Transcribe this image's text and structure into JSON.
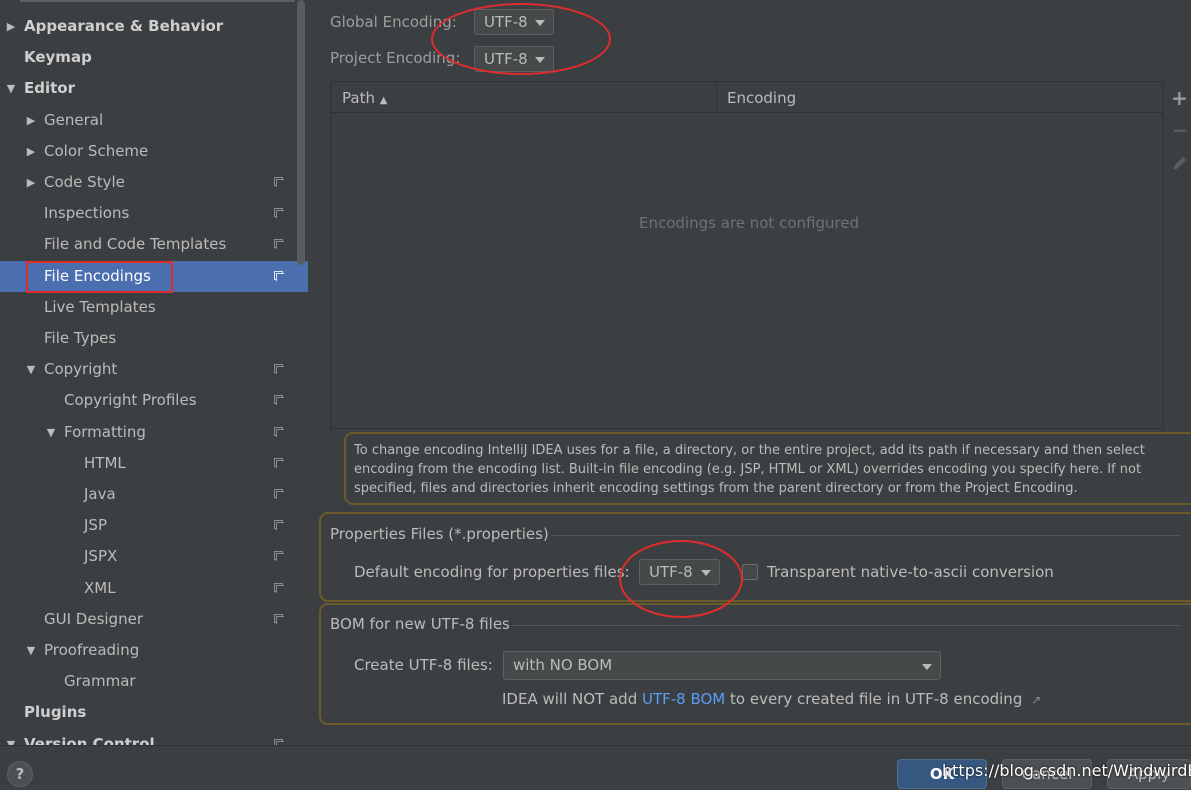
{
  "sidebar": {
    "items": [
      {
        "label": "Appearance & Behavior",
        "level": 0,
        "arrow": "right",
        "bold": true
      },
      {
        "label": "Keymap",
        "level": 0,
        "arrow": "",
        "bold": true
      },
      {
        "label": "Editor",
        "level": 0,
        "arrow": "down",
        "bold": true
      },
      {
        "label": "General",
        "level": 1,
        "arrow": "right"
      },
      {
        "label": "Color Scheme",
        "level": 1,
        "arrow": "right"
      },
      {
        "label": "Code Style",
        "level": 1,
        "arrow": "right",
        "project": true
      },
      {
        "label": "Inspections",
        "level": 1,
        "arrow": "",
        "project": true
      },
      {
        "label": "File and Code Templates",
        "level": 1,
        "arrow": "",
        "project": true
      },
      {
        "label": "File Encodings",
        "level": 1,
        "arrow": "",
        "project": true,
        "selected": true
      },
      {
        "label": "Live Templates",
        "level": 1,
        "arrow": ""
      },
      {
        "label": "File Types",
        "level": 1,
        "arrow": ""
      },
      {
        "label": "Copyright",
        "level": 1,
        "arrow": "down",
        "project": true
      },
      {
        "label": "Copyright Profiles",
        "level": 2,
        "arrow": "",
        "project": true
      },
      {
        "label": "Formatting",
        "level": 2,
        "arrow": "down",
        "project": true
      },
      {
        "label": "HTML",
        "level": 3,
        "arrow": "",
        "project": true
      },
      {
        "label": "Java",
        "level": 3,
        "arrow": "",
        "project": true
      },
      {
        "label": "JSP",
        "level": 3,
        "arrow": "",
        "project": true
      },
      {
        "label": "JSPX",
        "level": 3,
        "arrow": "",
        "project": true
      },
      {
        "label": "XML",
        "level": 3,
        "arrow": "",
        "project": true
      },
      {
        "label": "GUI Designer",
        "level": 1,
        "arrow": "",
        "project": true
      },
      {
        "label": "Proofreading",
        "level": 1,
        "arrow": "down"
      },
      {
        "label": "Grammar",
        "level": 2,
        "arrow": ""
      },
      {
        "label": "Plugins",
        "level": 0,
        "arrow": "",
        "bold": true
      },
      {
        "label": "Version Control",
        "level": 0,
        "arrow": "down",
        "bold": true,
        "project": true
      }
    ]
  },
  "encoding": {
    "global_label": "Global Encoding:",
    "global_value": "UTF-8",
    "project_label": "Project Encoding:",
    "project_value": "UTF-8"
  },
  "table": {
    "col_path": "Path",
    "col_encoding": "Encoding",
    "empty_text": "Encodings are not configured"
  },
  "info_text": "To change encoding IntelliJ IDEA uses for a file, a directory, or the entire project, add its path if necessary and then select encoding from the encoding list. Built-in file encoding (e.g. JSP, HTML or XML) overrides encoding you specify here. If not specified, files and directories inherit encoding settings from the parent directory or from the Project Encoding.",
  "properties": {
    "title": "Properties Files (*.properties)",
    "default_label": "Default encoding for properties files:",
    "default_value": "UTF-8",
    "transparent_label": "Transparent native-to-ascii conversion"
  },
  "bom": {
    "title": "BOM for new UTF-8 files",
    "create_label": "Create UTF-8 files:",
    "create_value": "with NO BOM",
    "note_prefix": "IDEA will NOT add ",
    "note_link": "UTF-8 BOM",
    "note_suffix": " to every created file in UTF-8 encoding"
  },
  "buttons": {
    "help": "?",
    "ok": "OK",
    "cancel": "Cancel",
    "apply": "Apply"
  },
  "watermark": "https://blog.csdn.net/WindwirdBird",
  "colors": {
    "selected_bg": "#4b6eaf",
    "panel_bg": "#3c3f41",
    "annotation_red": "#e02c2c",
    "group_border": "#6b5a2a",
    "link": "#589df6"
  }
}
